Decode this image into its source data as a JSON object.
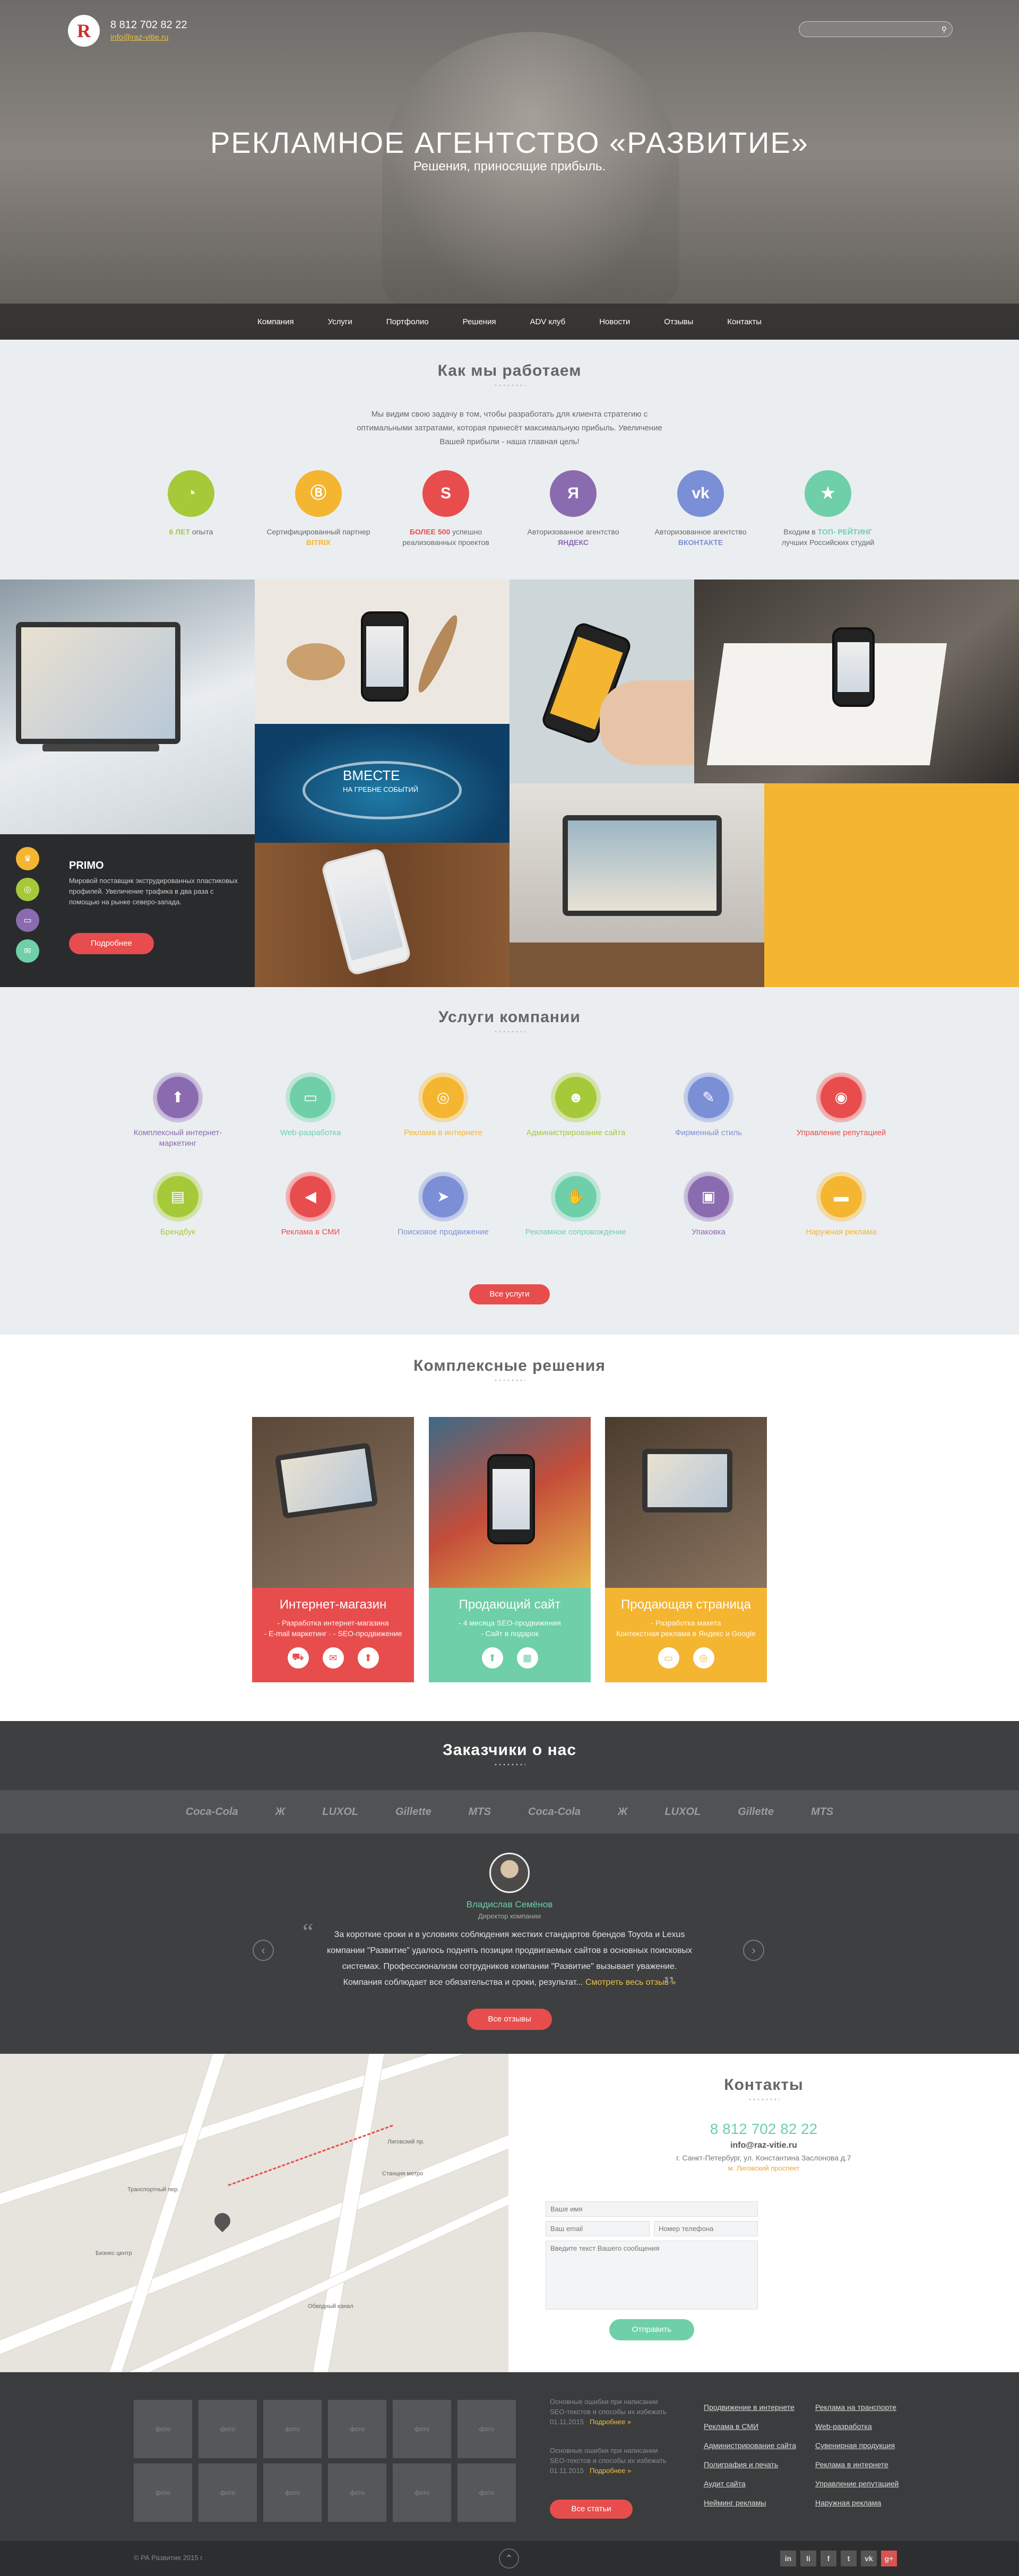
{
  "header": {
    "logo_letter": "R",
    "phone": "8 812 702 82 22",
    "email": "info@raz-vitie.ru",
    "search_placeholder": "",
    "title": "РЕКЛАМНОЕ АГЕНТСТВО «РАЗВИТИЕ»",
    "subtitle": "Решения, приносящие прибыль.",
    "nav": [
      "Компания",
      "Услуги",
      "Портфолио",
      "Решения",
      "ADV клуб",
      "Новости",
      "Отзывы",
      "Контакты"
    ]
  },
  "how": {
    "title": "Как мы работаем",
    "text": "Мы видим свою задачу в том, чтобы разработать для клиента стратегию с оптимальными затратами, которая принесёт максимальную прибыль. Увеличение Вашей прибыли - наша главная цель!",
    "features": [
      {
        "accent": "6 ЛЕТ",
        "rest": " опыта",
        "color": "#a6c93a",
        "accent_color": "#a6c93a",
        "icon": "clock-icon",
        "glyph": "◔"
      },
      {
        "accent": "",
        "rest": "Сертифицированный партнер ",
        "accent2": "BITRIX",
        "color": "#f4b531",
        "accent_color": "#f4b531",
        "icon": "bitrix-icon",
        "glyph": "Ⓑ"
      },
      {
        "accent": "БОЛЕЕ 500",
        "rest": " успешно реализованных проектов",
        "color": "#e84d4d",
        "accent_color": "#e84d4d",
        "icon": "superman-icon",
        "glyph": "S"
      },
      {
        "accent": "",
        "rest": "Авторизованное агентство ",
        "accent2": "ЯНДЕКС",
        "color": "#8a6bb0",
        "accent_color": "#8a6bb0",
        "icon": "yandex-icon",
        "glyph": "Я"
      },
      {
        "accent": "",
        "rest": "Авторизованное агентство ",
        "accent2": "ВКОНТАКТЕ",
        "color": "#7b8fd6",
        "accent_color": "#7b8fd6",
        "icon": "vk-icon",
        "glyph": "vk"
      },
      {
        "accent": "",
        "rest": "Входим в ",
        "accent2": "ТОП- РЕЙТИНГ",
        "rest2": " лучших Российских студий",
        "color": "#6ecfa8",
        "accent_color": "#6ecfa8",
        "icon": "rating-icon",
        "glyph": "★"
      }
    ]
  },
  "portfolio": {
    "primo_title": "PRIMO",
    "primo_text": "Мировой поставщик экструдированных пластиковых профилей. Увеличение трафика в два раза с помощью на рынке северо-запада.",
    "primo_button": "Подробнее",
    "vmeste_title": "ВМЕСТЕ",
    "vmeste_sub": "НА ГРЕБНЕ СОБЫТИЙ",
    "side_icons": [
      "award-icon",
      "target-icon",
      "monitor-icon",
      "chat-icon"
    ]
  },
  "services": {
    "title": "Услуги компании",
    "row1": [
      {
        "label": "Комплексный интернет-маркетинг",
        "color": "#8a6bb0",
        "icon": "rocket-icon",
        "glyph": "⬆"
      },
      {
        "label": "Web-разработка",
        "color": "#6ecfa8",
        "icon": "monitor-icon",
        "glyph": "▭"
      },
      {
        "label": "Реклама в интернете",
        "color": "#f4b531",
        "icon": "target-icon",
        "glyph": "◎"
      },
      {
        "label": "Администрирование сайта",
        "color": "#a6c93a",
        "icon": "admin-icon",
        "glyph": "☻"
      },
      {
        "label": "Фирменный стиль",
        "color": "#7b8fd6",
        "icon": "palette-icon",
        "glyph": "✎"
      },
      {
        "label": "Управление репутацией",
        "color": "#e84d4d",
        "icon": "mask-icon",
        "glyph": "◉"
      }
    ],
    "row2": [
      {
        "label": "Брендбук",
        "color": "#a6c93a",
        "icon": "book-icon",
        "glyph": "▤"
      },
      {
        "label": "Реклама в СМИ",
        "color": "#e84d4d",
        "icon": "megaphone-icon",
        "glyph": "◀"
      },
      {
        "label": "Поисковое продвижение",
        "color": "#7b8fd6",
        "icon": "paper-plane-icon",
        "glyph": "➤"
      },
      {
        "label": "Рекламное сопровождение",
        "color": "#6ecfa8",
        "icon": "handshake-icon",
        "glyph": "✋"
      },
      {
        "label": "Упаковка",
        "color": "#8a6bb0",
        "icon": "box-icon",
        "glyph": "▣"
      },
      {
        "label": "Наружная реклама",
        "color": "#f4b531",
        "icon": "billboard-icon",
        "glyph": "▬"
      }
    ],
    "button": "Все услуги"
  },
  "complex": {
    "title": "Комплексные решения",
    "cards": [
      {
        "title": "Интернет-магазин",
        "lines": [
          "- Разработка интернет-магазина",
          "- E-mail маркетинг · - SEO-продвижение"
        ],
        "color": "#e84d4d"
      },
      {
        "title": "Продающий сайт",
        "lines": [
          "- 4 месяца SEO-продвижения",
          "- Сайт в подарок"
        ],
        "color": "#6ecfa8"
      },
      {
        "title": "Продающая страница",
        "lines": [
          "- Разработка макета",
          "Контекстная реклама в Яндекс и Google"
        ],
        "color": "#f4b531"
      }
    ]
  },
  "clients": {
    "title": "Заказчики о нас",
    "logos": [
      "Coca-Cola",
      "Ж",
      "LUXOL",
      "Gillette",
      "MTS",
      "Coca-Cola",
      "Ж",
      "LUXOL",
      "Gillette",
      "MTS"
    ],
    "name": "Владислав Семёнов",
    "role": "Директор компании",
    "quote": "За короткие сроки и в условиях соблюдения жестких стандартов брендов Toyota и Lexus компании \"Развитие\" удалось поднять позиции продвигаемых сайтов в основных поисковых системах. Профессионализм сотрудников компании \"Развитие\" вызывает уважение. Компания соблюдает все обязательства и сроки, результат...",
    "more": "Смотреть весь отзыв »",
    "button": "Все отзывы"
  },
  "contacts": {
    "title": "Контакты",
    "phone": "8 812 702 82 22",
    "email": "info@raz-vitie.ru",
    "address": "г. Санкт-Петербург, ул. Константина Заслонова д.7",
    "metro": "м. Лиговский проспект",
    "name_placeholder": "Ваше имя",
    "email_placeholder": "Ваш email",
    "phone_placeholder": "Номер телефона",
    "message_placeholder": "Введите текст Вашего сообщения",
    "submit": "Отправить",
    "map_labels": [
      "Лиговский пр.",
      "Транспортный пер.",
      "Обводный канал",
      "Бизнес центр",
      "Станция метро"
    ]
  },
  "footer": {
    "photo_label": "фото",
    "photo_count": 12,
    "news1": "Основные ошибки при написании SEO-текстов и способы их избежать",
    "news1_date": "01.11.2015",
    "news2": "Основные ошибки при написании SEO-текстов и способы их избежать",
    "news2_date": "01.11.2015",
    "more": "Подробнее »",
    "all_articles": "Все статьи",
    "links_col1": [
      "Продвижение в интернете",
      "Реклама в СМИ",
      "Администрирование сайта",
      "Полиграфия и печать",
      "Аудит сайта",
      "Нейминг рекламы"
    ],
    "links_col2": [
      "Реклама на транспорте",
      "Web-разработка",
      "Сувенирная продукция",
      "Реклама в интернете",
      "Управление репутацией",
      "Наружная реклама"
    ],
    "copyright": "© РА Развитие 2015 г",
    "social": [
      "in",
      "li",
      "f",
      "t",
      "vk",
      "g+"
    ]
  }
}
